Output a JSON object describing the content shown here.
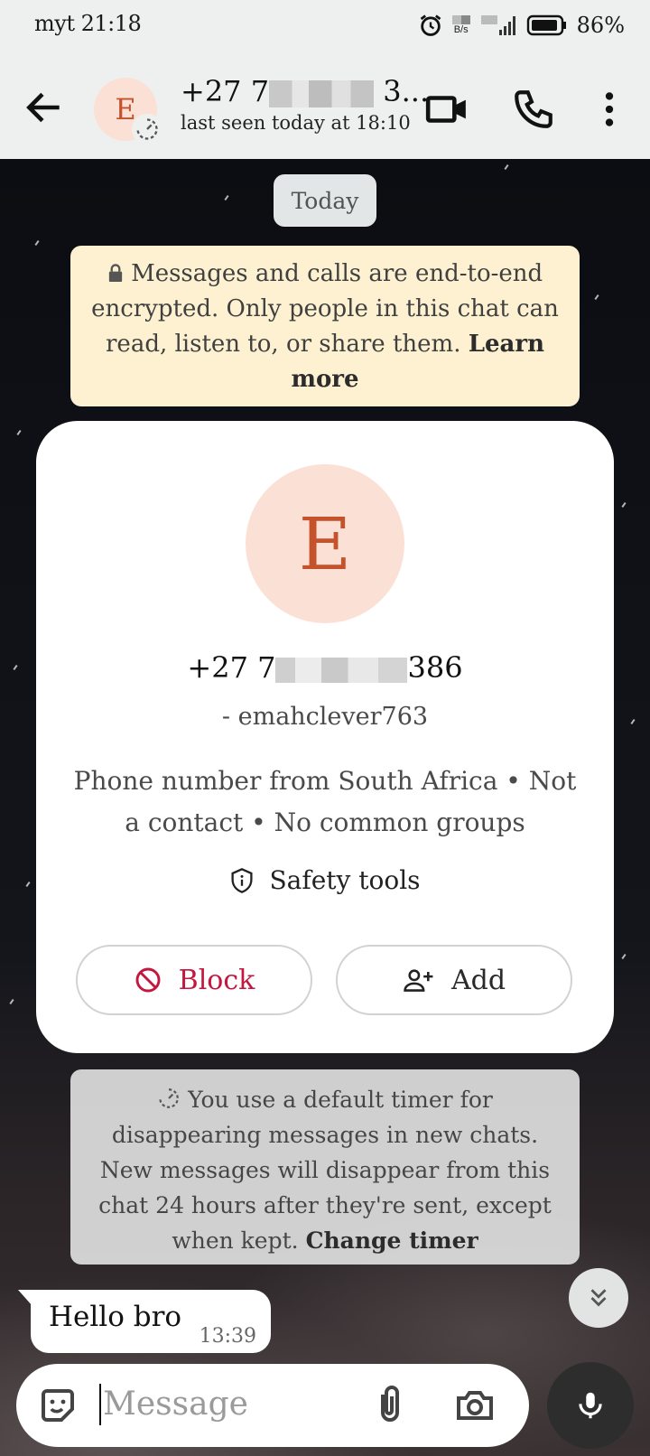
{
  "status_bar": {
    "carrier_time": "myt 21:18",
    "speed_unit": "B/s",
    "battery": "86%"
  },
  "header": {
    "avatar_letter": "E",
    "title_prefix": "+27 7",
    "title_suffix": " 3...",
    "subtitle": "last seen today at 18:10",
    "icons": [
      "back-arrow-icon",
      "video-call-icon",
      "phone-icon",
      "more-vert-icon"
    ]
  },
  "chat": {
    "date_chip": "Today",
    "encryption": {
      "text": "Messages and calls are end-to-end encrypted. Only people in this chat can read, listen to, or share them.",
      "link": "Learn more"
    },
    "contact_card": {
      "avatar_letter": "E",
      "phone_prefix": "+27 7",
      "phone_suffix": "386",
      "username": "- emahclever763",
      "info": "Phone number from South Africa • Not a contact • No common groups",
      "safety_label": "Safety tools",
      "block_label": "Block",
      "add_label": "Add"
    },
    "timer_notice": {
      "text": "You use a default timer for disappearing messages in new chats. New messages will disappear from this chat 24 hours after they're sent, except when kept.",
      "link": "Change timer"
    },
    "messages": [
      {
        "text": "Hello bro",
        "time": "13:39"
      }
    ]
  },
  "composer": {
    "placeholder": "Message"
  },
  "colors": {
    "appbar_bg": "#eef0ef",
    "avatar_bg": "#fbe0d6",
    "avatar_fg": "#c4532b",
    "block_red": "#c4173f",
    "notice_yellow": "#fdf1d2"
  }
}
